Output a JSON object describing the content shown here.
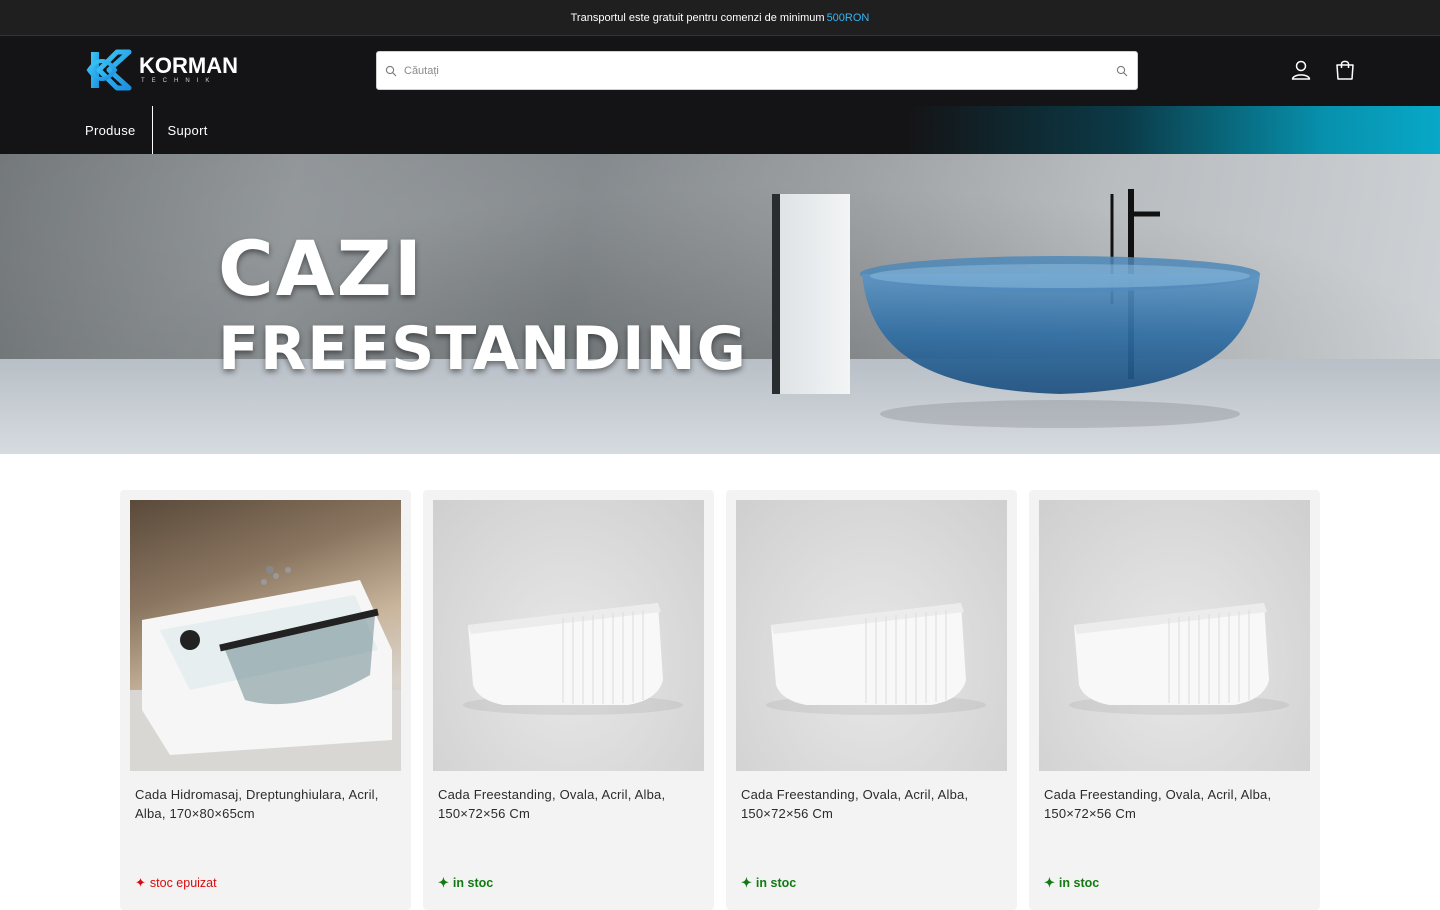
{
  "announcement": {
    "text": "Transportul este gratuit pentru comenzi de minimum",
    "highlight": "500RON"
  },
  "logo": {
    "main": "KORMAN",
    "sub": "TECHNIK"
  },
  "search": {
    "placeholder": "Căutați"
  },
  "nav": {
    "items": [
      {
        "label": "Produse"
      },
      {
        "label": "Suport"
      }
    ]
  },
  "hero": {
    "line1": "CAZI",
    "line2": "FREESTANDING"
  },
  "products": [
    {
      "title": "Cada Hidromasaj, Dreptunghiulara, Acril, Alba, 170×80×65cm",
      "stock": "stoc epuizat",
      "stock_status": "out"
    },
    {
      "title": "Cada Freestanding, Ovala, Acril, Alba, 150×72×56 Cm",
      "stock": "in stoc",
      "stock_status": "in"
    },
    {
      "title": "Cada Freestanding, Ovala, Acril, Alba, 150×72×56 Cm",
      "stock": "in stoc",
      "stock_status": "in"
    },
    {
      "title": "Cada Freestanding, Ovala, Acril, Alba, 150×72×56 Cm",
      "stock": "in stoc",
      "stock_status": "in"
    }
  ],
  "colors": {
    "accent": "#35b6f0",
    "in_stock": "#137a13",
    "out_of_stock": "#d90b0b",
    "header_bg": "#141416"
  },
  "icons": {
    "search": "search-icon",
    "account": "account-icon",
    "cart": "cart-icon"
  }
}
